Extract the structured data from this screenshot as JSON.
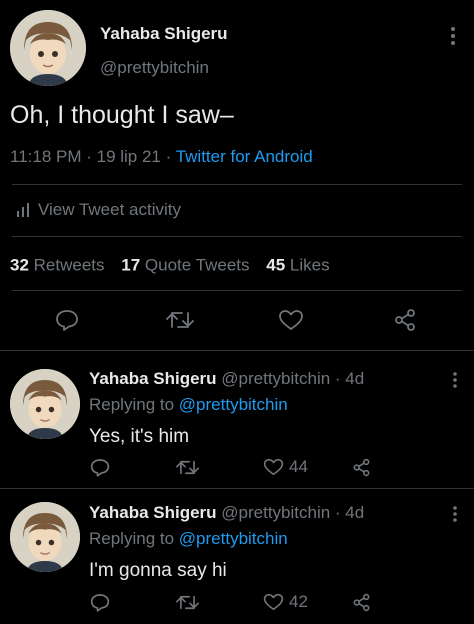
{
  "main_tweet": {
    "author_name": "Yahaba Shigeru",
    "author_handle": "@prettybitchin",
    "text": "Oh, I thought I saw–",
    "time": "11:18 PM · 19 lip 21 ·",
    "client": "Twitter for Android",
    "activity_label": "View Tweet activity",
    "stats": {
      "retweets_count": "32",
      "retweets_label": "Retweets",
      "quotes_count": "17",
      "quotes_label": "Quote Tweets",
      "likes_count": "45",
      "likes_label": "Likes"
    }
  },
  "replies": [
    {
      "author_name": "Yahaba Shigeru",
      "meta": "@prettybitchin · 4d",
      "replying_prefix": "Replying to",
      "replying_to": "@prettybitchin",
      "text": "Yes, it's him",
      "likes": "44"
    },
    {
      "author_name": "Yahaba Shigeru",
      "meta": "@prettybitchin · 4d",
      "replying_prefix": "Replying to",
      "replying_to": "@prettybitchin",
      "text": "I'm gonna say hi",
      "likes": "42"
    }
  ],
  "icons": [
    "more-icon",
    "bar-chart-icon",
    "reply-icon",
    "retweet-icon",
    "like-icon",
    "share-icon"
  ],
  "colors": {
    "background": "#000000",
    "text": "#e7e9ea",
    "muted": "#71767b",
    "link": "#1d9bf0",
    "divider": "#2f3336"
  }
}
